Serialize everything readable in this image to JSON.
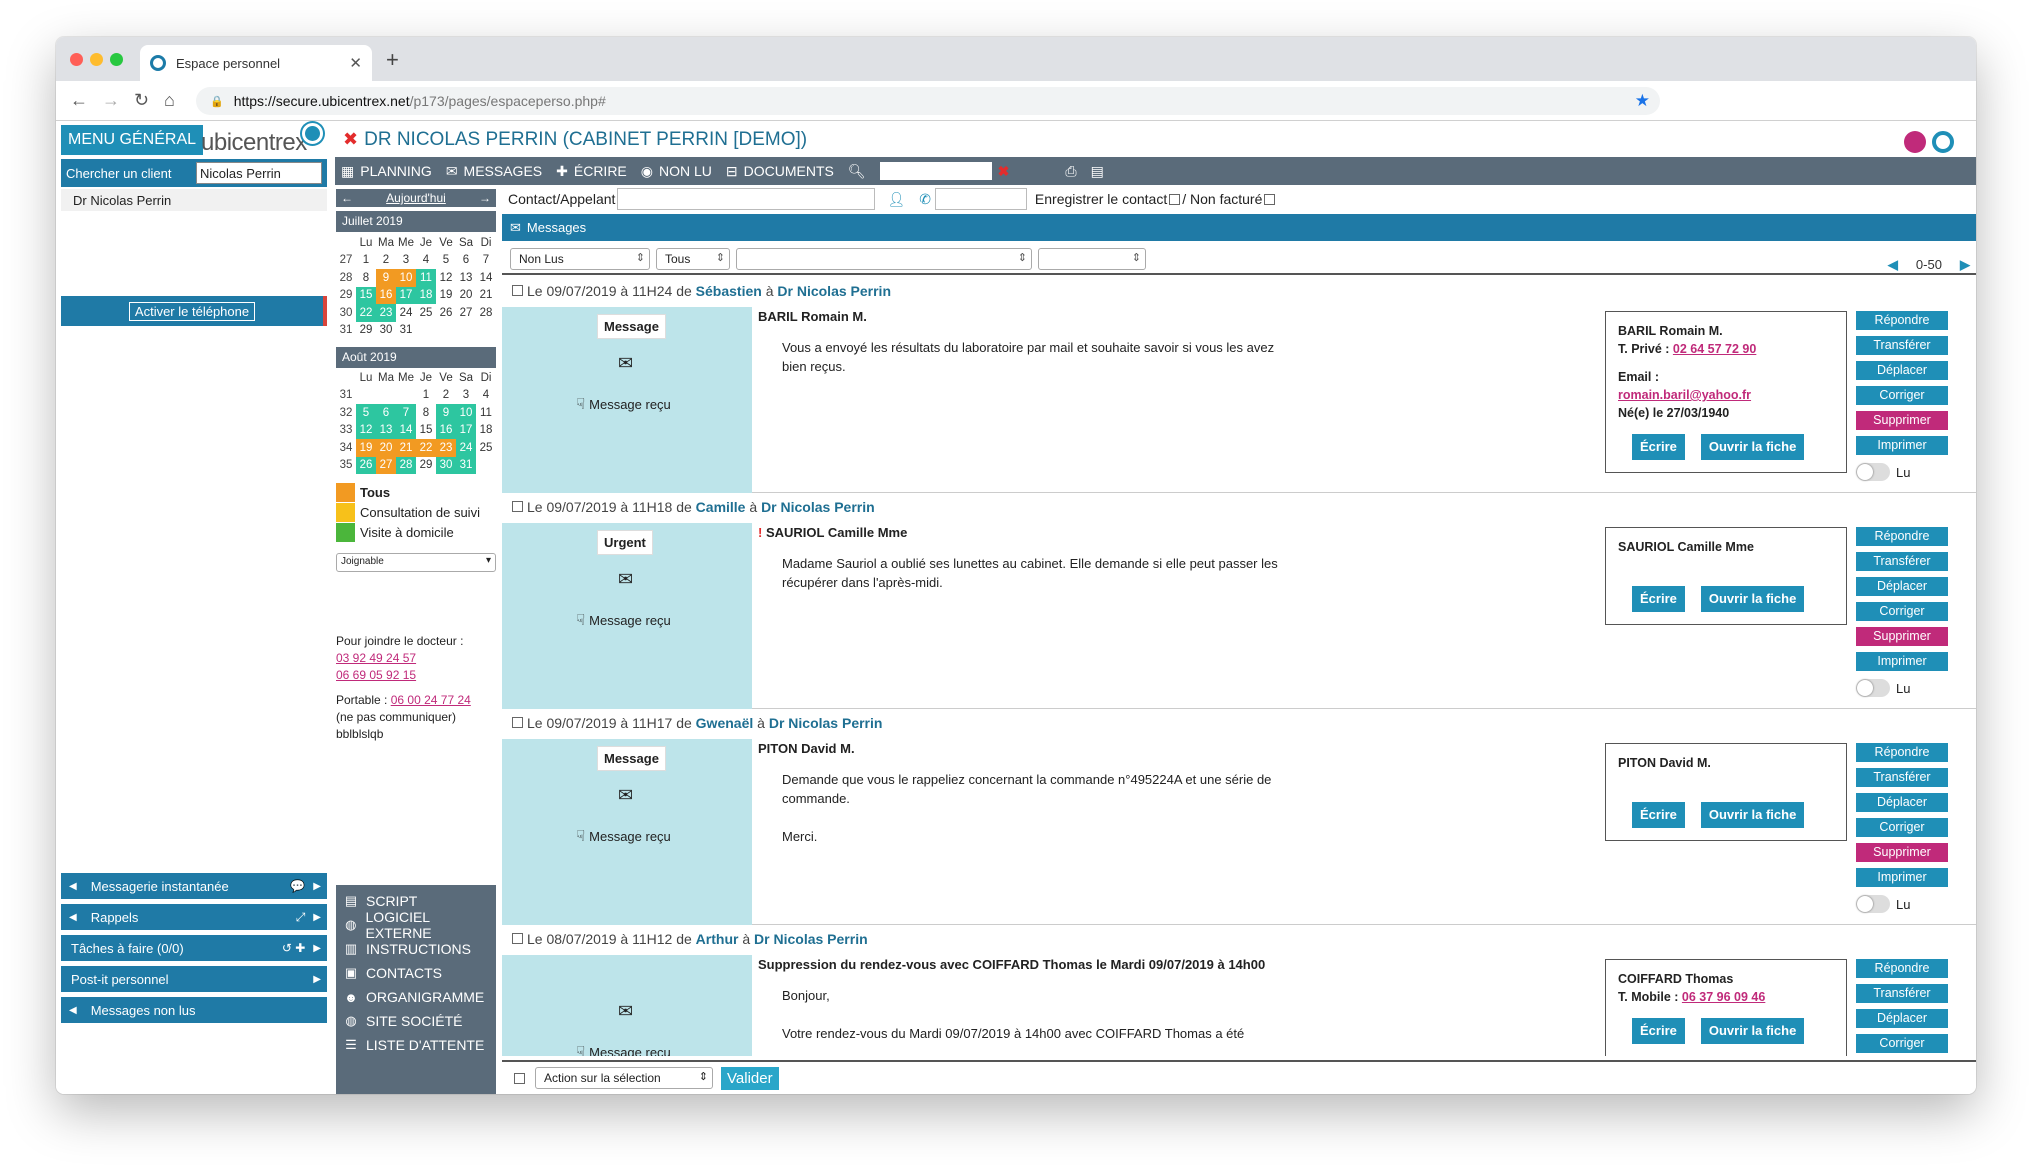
{
  "browser": {
    "tab_title": "Espace personnel",
    "url_host": "https://secure.ubicentrex.net",
    "url_path": "/p173/pages/espaceperso.php#"
  },
  "left": {
    "menu": "MENU GÉNÉRAL",
    "logo": "ubicentrex",
    "search_label": "Chercher un client",
    "search_value": "Nicolas Perrin",
    "client": "Dr Nicolas Perrin",
    "phone_btn": "Activer le téléphone",
    "side_items": [
      "Messagerie instantanée",
      "Rappels",
      "Tâches à faire (0/0)",
      "Post-it personnel",
      "Messages non lus"
    ]
  },
  "header": {
    "title": "DR NICOLAS PERRIN (CABINET PERRIN [DEMO])"
  },
  "toolbar": {
    "planning": "PLANNING",
    "messages": "MESSAGES",
    "ecrire": "ÉCRIRE",
    "nonlu": "NON LU",
    "documents": "DOCUMENTS"
  },
  "calendar": {
    "today": "Aujourd'hui",
    "days": [
      "Lu",
      "Ma",
      "Me",
      "Je",
      "Ve",
      "Sa",
      "Di"
    ],
    "months": [
      {
        "name": "Juillet 2019",
        "weeks": [
          [
            "27",
            "1",
            "2",
            "3",
            "4",
            "5",
            "6",
            "7"
          ],
          [
            "28",
            "8",
            "9",
            "10",
            "11",
            "12",
            "13",
            "14"
          ],
          [
            "29",
            "15",
            "16",
            "17",
            "18",
            "19",
            "20",
            "21"
          ],
          [
            "30",
            "22",
            "23",
            "24",
            "25",
            "26",
            "27",
            "28"
          ],
          [
            "31",
            "29",
            "30",
            "31",
            "",
            "",
            "",
            ""
          ]
        ]
      },
      {
        "name": "Août 2019",
        "weeks": [
          [
            "31",
            "",
            "",
            "",
            "1",
            "2",
            "3",
            "4"
          ],
          [
            "32",
            "5",
            "6",
            "7",
            "8",
            "9",
            "10",
            "11"
          ],
          [
            "33",
            "12",
            "13",
            "14",
            "15",
            "16",
            "17",
            "18"
          ],
          [
            "34",
            "19",
            "20",
            "21",
            "22",
            "23",
            "24",
            "25"
          ],
          [
            "35",
            "26",
            "27",
            "28",
            "29",
            "30",
            "31",
            ""
          ]
        ]
      }
    ],
    "legend": [
      {
        "label": "Tous",
        "color": "#f29a22"
      },
      {
        "label": "Consultation de suivi",
        "color": "#f7c11a"
      },
      {
        "label": "Visite à domicile",
        "color": "#2dc6a0"
      }
    ],
    "select": "Joignable",
    "doc_label": "Pour joindre le docteur :",
    "doc_phone1": "03 92 49 24 57",
    "doc_phone2": "06 69 05 92 15",
    "portable_label": "Portable :",
    "portable": "06 00 24 77 24",
    "note1": "(ne pas communiquer)",
    "note2": "bblblslqb"
  },
  "tools": [
    "SCRIPT",
    "LOGICIEL EXTERNE",
    "INSTRUCTIONS",
    "CONTACTS",
    "ORGANIGRAMME",
    "SITE SOCIÉTÉ",
    "LISTE D'ATTENTE"
  ],
  "contact": {
    "label": "Contact/Appelant",
    "save": "Enregistrer le contact",
    "nonfact": "/ Non facturé"
  },
  "messages_bar": "Messages",
  "filters": {
    "status": "Non Lus",
    "who": "Tous",
    "pager": "0-50"
  },
  "messages": [
    {
      "head_pre": "Le 09/07/2019 à 11H24 de ",
      "from": "Sébastien",
      "mid": " à ",
      "to": "Dr Nicolas Perrin",
      "type": "Message",
      "recv": "Message reçu",
      "title": "BARIL Romain M.",
      "urgent": "",
      "text": "Vous a envoyé les résultats du laboratoire par mail et souhaite savoir si vous les avez bien reçus.",
      "card_name": "BARIL Romain M.",
      "card_tel_label": "T. Privé :",
      "card_tel": "02 64 57 72 90",
      "card_email_label": "Email :",
      "card_email": "romain.baril@yahoo.fr",
      "card_born": "Né(e) le 27/03/1940"
    },
    {
      "head_pre": "Le 09/07/2019 à 11H18 de ",
      "from": "Camille",
      "mid": " à ",
      "to": "Dr Nicolas Perrin",
      "type": "Urgent",
      "recv": "Message reçu",
      "title": "SAURIOL Camille Mme",
      "urgent": "!",
      "text": "Madame Sauriol a oublié ses lunettes au cabinet. Elle demande si elle peut passer les récupérer dans l'après-midi.",
      "card_name": "SAURIOL Camille Mme",
      "card_tel_label": "",
      "card_tel": "",
      "card_email_label": "",
      "card_email": "",
      "card_born": ""
    },
    {
      "head_pre": "Le 09/07/2019 à 11H17 de ",
      "from": "Gwenaël",
      "mid": " à ",
      "to": "Dr Nicolas Perrin",
      "type": "Message",
      "recv": "Message reçu",
      "title": "PITON David M.",
      "urgent": "",
      "text": "Demande que vous le rappeliez concernant la commande n°495224A et une série de commande.\n\nMerci.",
      "card_name": "PITON David M.",
      "card_tel_label": "",
      "card_tel": "",
      "card_email_label": "",
      "card_email": "",
      "card_born": ""
    },
    {
      "head_pre": "Le 08/07/2019 à 11H12 de ",
      "from": "Arthur",
      "mid": " à ",
      "to": "Dr Nicolas Perrin",
      "type": "",
      "recv": "Message reçu",
      "title": "Suppression du rendez-vous avec COIFFARD Thomas le Mardi 09/07/2019 à 14h00",
      "urgent": "",
      "text": "Bonjour,\n\nVotre rendez-vous du Mardi 09/07/2019 à 14h00 avec COIFFARD Thomas a été",
      "card_name": "COIFFARD Thomas",
      "card_tel_label": "T. Mobile :",
      "card_tel": "06 37 96 09 46",
      "card_email_label": "",
      "card_email": "",
      "card_born": ""
    }
  ],
  "card_buttons": {
    "write": "Écrire",
    "open": "Ouvrir la fiche"
  },
  "actions": [
    "Répondre",
    "Transférer",
    "Déplacer",
    "Corriger",
    "Supprimer",
    "Imprimer"
  ],
  "toggle_label": "Lu",
  "bottom": {
    "action": "Action sur la sélection",
    "validate": "Valider"
  }
}
